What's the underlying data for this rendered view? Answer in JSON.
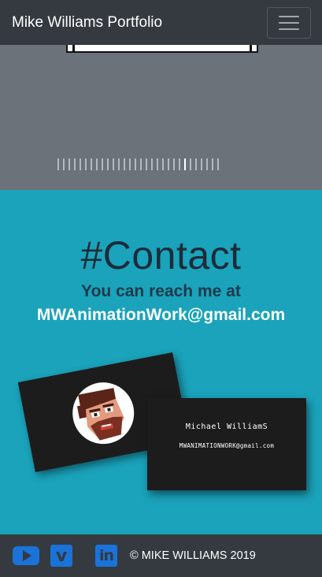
{
  "navbar": {
    "brand": "Mike Williams Portfolio",
    "toggler_icon": "hamburger-icon"
  },
  "carousel": {
    "indicator_count": 30,
    "active_index": 23
  },
  "contact": {
    "heading": "#Contact",
    "subheading": "You can reach me at",
    "email": "MWAnimationWork@gmail.com",
    "card": {
      "name": "Michael WilliamS",
      "email": "MWANIMATIONWORK@gmail.com"
    }
  },
  "footer": {
    "social_icons": [
      "youtube-icon",
      "vimeo-icon",
      "linkedin-icon"
    ],
    "vimeo_glyph": "v",
    "linkedin_glyph": "in",
    "copyright": "© MIKE WILLIAMS 2019"
  },
  "colors": {
    "navbar": "#343a40",
    "contact_bg": "#1aa3bb",
    "carousel_bg": "#6c727a",
    "social_blue": "#1a73d9"
  }
}
